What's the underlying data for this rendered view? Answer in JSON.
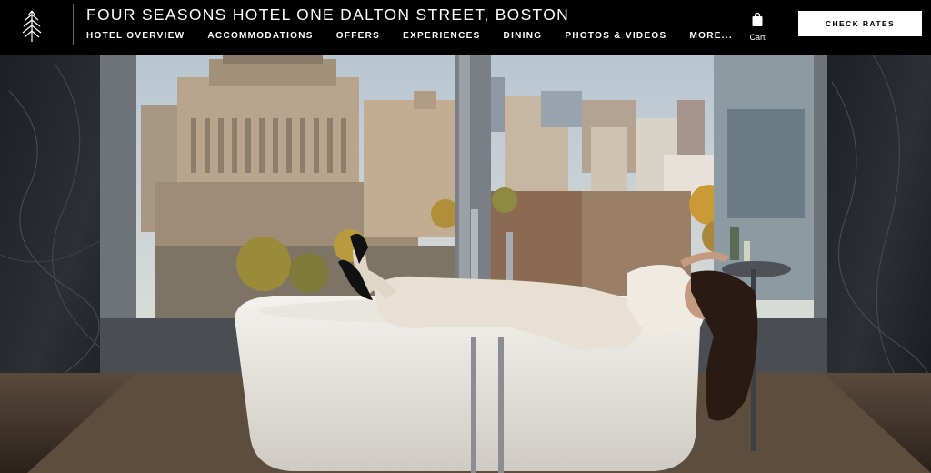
{
  "header": {
    "title": "FOUR SEASONS HOTEL ONE DALTON STREET, BOSTON",
    "logo_icon": "four-seasons-tree-icon",
    "nav": [
      {
        "label": "HOTEL OVERVIEW"
      },
      {
        "label": "ACCOMMODATIONS"
      },
      {
        "label": "OFFERS"
      },
      {
        "label": "EXPERIENCES"
      },
      {
        "label": "DINING"
      },
      {
        "label": "PHOTOS & VIDEOS"
      },
      {
        "label": "MORE..."
      }
    ],
    "cart_label": "Cart",
    "cart_icon": "shopping-bag-icon",
    "cta_label": "CHECK RATES"
  },
  "colors": {
    "header_bg": "#000000",
    "cta_bg": "#ffffff",
    "text": "#ffffff"
  }
}
